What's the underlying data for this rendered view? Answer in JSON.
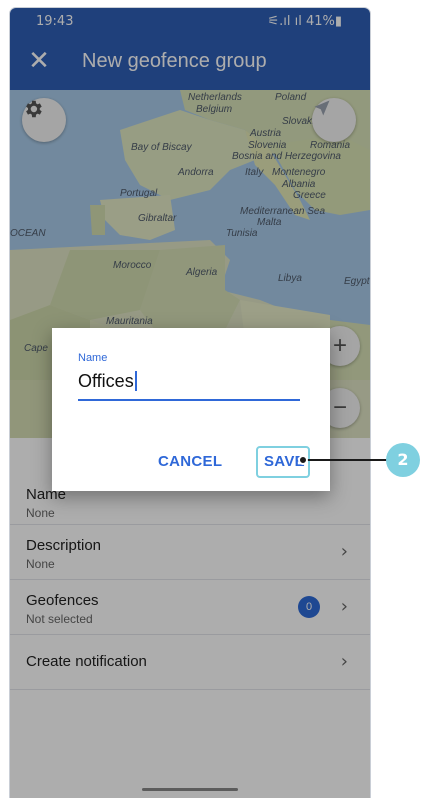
{
  "status_bar": {
    "time": "19:43",
    "right": "⚟.ıl ıl 41%▮"
  },
  "app_bar": {
    "title": "New geofence group"
  },
  "map": {
    "labels": [
      "Netherlands",
      "Poland",
      "Belgium",
      "Slovakia",
      "Austria",
      "Bay of Biscay",
      "Slovenia",
      "Romania",
      "Bosnia and Herzegovina",
      "Andorra",
      "Italy",
      "Montenegro",
      "Albania",
      "Portugal",
      "Greece",
      "Gibraltar",
      "Mediterranean Sea",
      "Malta",
      "OCEAN",
      "Tunisia",
      "Morocco",
      "Algeria",
      "Libya",
      "Egypt",
      "Mauritania",
      "Cape"
    ],
    "zoom_in": "+",
    "zoom_out": "−"
  },
  "sheet": {
    "rows": [
      {
        "title": "Name",
        "subtitle": "None"
      },
      {
        "title": "Description",
        "subtitle": "None"
      },
      {
        "title": "Geofences",
        "subtitle": "Not selected",
        "badge": "0"
      },
      {
        "title": "Create notification"
      }
    ]
  },
  "dialog": {
    "field_label": "Name",
    "field_value": "Offices",
    "cancel": "CANCEL",
    "save": "SAVE"
  },
  "callout": {
    "number": "2",
    "color": "#7fd0e0"
  },
  "colors": {
    "primary": "#2f5fb6",
    "accent": "#2f68d8"
  }
}
